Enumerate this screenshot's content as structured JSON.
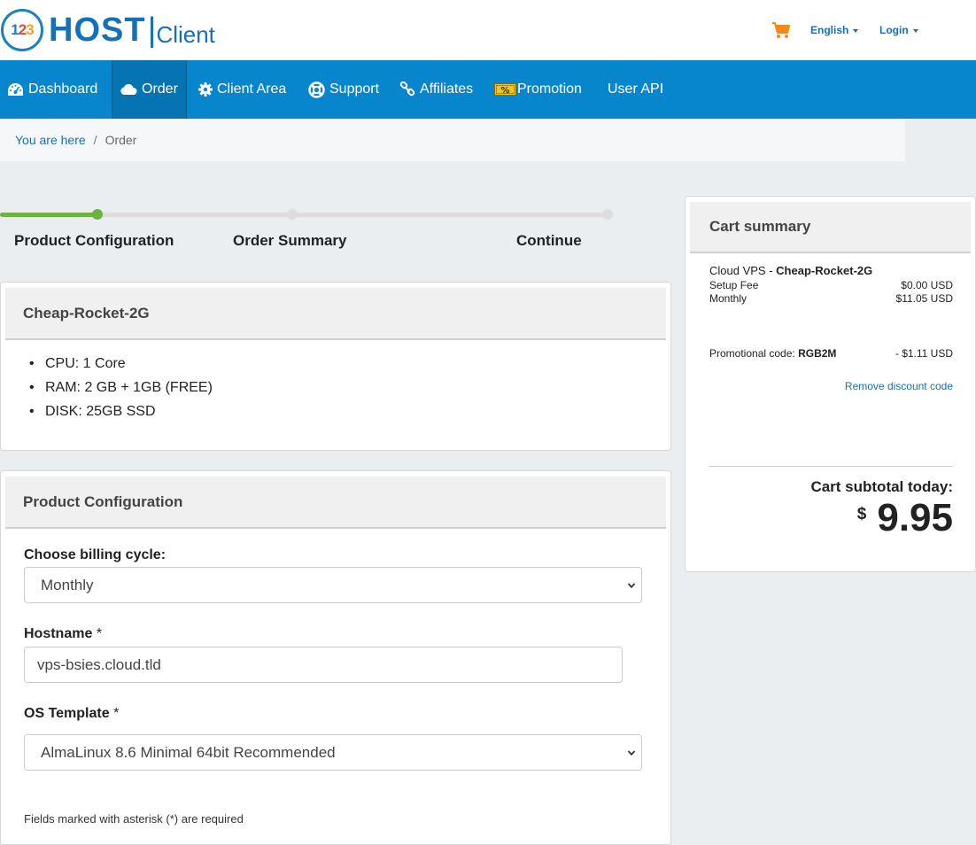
{
  "brand": {
    "badge_digits": [
      "1",
      "2",
      "3"
    ],
    "name_host": "HOST",
    "name_sep": "|",
    "name_client": "Client"
  },
  "header": {
    "cart_icon": "shopping-cart-icon",
    "language_label": "English",
    "login_label": "Login"
  },
  "colors": {
    "nav_bg": "#0786cd",
    "nav_active": "#0674b3",
    "accent_link": "#1570b8",
    "progress_done": "#6cb33f",
    "cart_icon": "#f28c18"
  },
  "nav": {
    "items": [
      {
        "label": "Dashboard",
        "icon": "tachometer-icon"
      },
      {
        "label": "Order",
        "icon": "cloud-icon",
        "active": true
      },
      {
        "label": "Client Area",
        "icon": "gear-icon"
      },
      {
        "label": "Support",
        "icon": "lifebuoy-icon"
      },
      {
        "label": "Affiliates",
        "icon": "link-icon"
      },
      {
        "label": "Promotion",
        "icon": "percent-ticket-icon"
      },
      {
        "label": "User API",
        "icon": ""
      }
    ]
  },
  "breadcrumb": {
    "root": "You are here",
    "separator": "/",
    "current": "Order"
  },
  "steps": {
    "progress_fraction": 0.16,
    "items": [
      {
        "label": "Product Configuration",
        "done": true
      },
      {
        "label": "Order Summary",
        "done": false
      },
      {
        "label": "Continue",
        "done": false
      }
    ]
  },
  "product": {
    "title": "Cheap-Rocket-2G",
    "features": [
      "CPU: 1 Core",
      "RAM: 2 GB + 1GB (FREE)",
      "DISK: 25GB SSD"
    ]
  },
  "config": {
    "title": "Product Configuration",
    "billing_label": "Choose billing cycle:",
    "billing_value": "Monthly",
    "hostname_label": "Hostname",
    "hostname_value": "vps-bsies.cloud.tld",
    "os_label": "OS Template",
    "os_value": "AlmaLinux 8.6 Minimal 64bit Recommended",
    "required_marker": "*",
    "note": "Fields marked with asterisk (*) are required"
  },
  "cart": {
    "title": "Cart summary",
    "product_group": "Cloud VPS - ",
    "product_name": "Cheap-Rocket-2G",
    "setup_label": "Setup Fee",
    "setup_value": "$0.00 USD",
    "monthly_label": "Monthly",
    "monthly_value": "$11.05 USD",
    "promo_label": "Promotional code: ",
    "promo_code": "RGB2M",
    "promo_value": "- $1.11 USD",
    "remove_label": "Remove discount code",
    "subtotal_label": "Cart subtotal today:",
    "subtotal_currency": "$",
    "subtotal_value": "9.95"
  }
}
